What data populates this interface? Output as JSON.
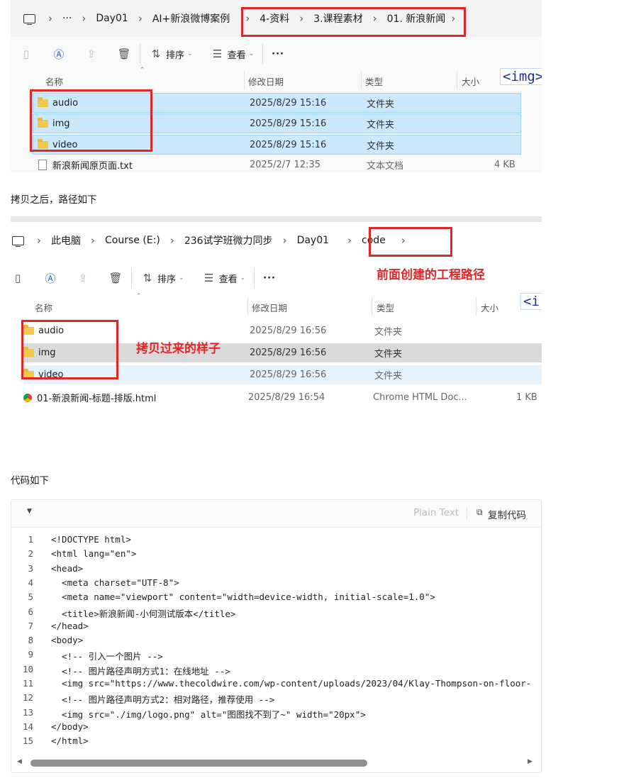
{
  "shot1": {
    "breadcrumb": [
      "···",
      "Day01",
      "AI+新浪微博案例",
      "4-资料",
      "3.课程素材",
      "01. 新浪新闻"
    ],
    "toolbar": {
      "sort": "排序",
      "view": "查看",
      "more": "···"
    },
    "columns": [
      "名称",
      "修改日期",
      "类型",
      "大小"
    ],
    "img_tag": "<img>",
    "rows": [
      {
        "name": "audio",
        "date": "2025/8/29 15:16",
        "type": "文件夹",
        "size": ""
      },
      {
        "name": "img",
        "date": "2025/8/29 15:16",
        "type": "文件夹",
        "size": ""
      },
      {
        "name": "video",
        "date": "2025/8/29 15:16",
        "type": "文件夹",
        "size": ""
      },
      {
        "name": "新浪新闻原页面.txt",
        "date": "2025/2/7 12:35",
        "type": "文本文档",
        "size": "4 KB"
      }
    ]
  },
  "caption1": "拷贝之后，路径如下",
  "shot2": {
    "breadcrumb": [
      "此电脑",
      "Course (E:)",
      "236试学班微力同步",
      "Day01",
      "code"
    ],
    "toolbar": {
      "sort": "排序",
      "view": "查看",
      "more": "···"
    },
    "annotation_path": "前面创建的工程路径",
    "annotation_copy": "拷贝过来的样子",
    "columns": [
      "名称",
      "修改日期",
      "类型",
      "大小"
    ],
    "img_tag": "<i",
    "rows": [
      {
        "name": "audio",
        "date": "2025/8/29 16:56",
        "type": "文件夹",
        "size": ""
      },
      {
        "name": "img",
        "date": "2025/8/29 16:56",
        "type": "文件夹",
        "size": ""
      },
      {
        "name": "video",
        "date": "2025/8/29 16:56",
        "type": "文件夹",
        "size": ""
      },
      {
        "name": "01-新浪新闻-标题-排版.html",
        "date": "2025/8/29 16:54",
        "type": "Chrome HTML Doc...",
        "size": "1 KB"
      }
    ]
  },
  "caption2": "代码如下",
  "code": {
    "language": "Plain Text",
    "copy_label": "复制代码",
    "lines": [
      "<!DOCTYPE html>",
      "<html lang=\"en\">",
      "<head>",
      "  <meta charset=\"UTF-8\">",
      "  <meta name=\"viewport\" content=\"width=device-width, initial-scale=1.0\">",
      "  <title>新浪新闻-小何测试版本</title>",
      "</head>",
      "<body>",
      "  <!-- 引入一个图片 -->",
      "  <!-- 图片路径声明方式1：在线地址 -->",
      "  <img src=\"https://www.thecoldwire.com/wp-content/uploads/2023/04/Klay-Thompson-on-floor-",
      "  <!-- 图片路径声明方式2：相对路径，推荐使用 -->",
      "  <img src=\"./img/logo.png\" alt=\"图图找不到了~\" width=\"20px\">",
      "</body>",
      "</html>"
    ]
  },
  "colors": {
    "highlight": "#e02727",
    "selected_row": "#cce8ff",
    "selected_border": "#99d1ff"
  }
}
